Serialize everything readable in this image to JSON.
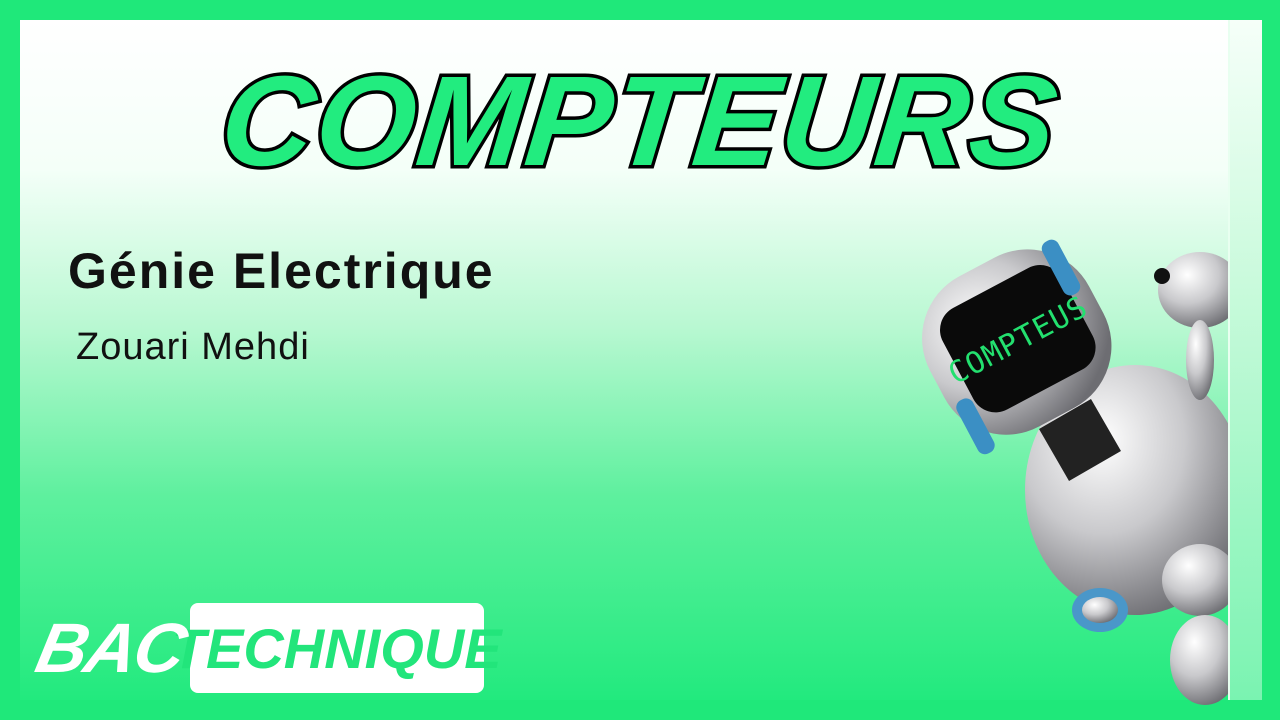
{
  "title": "COMPTEURS",
  "subject": "Génie Electrique",
  "author": "Zouari Mehdi",
  "logo": {
    "part1": "BAC",
    "part2": "TECHNIQUE"
  },
  "robot_visor_text": "COMPTEUS",
  "colors": {
    "border": "#1fe87a",
    "accent": "#22ec7f",
    "text": "#111111"
  }
}
